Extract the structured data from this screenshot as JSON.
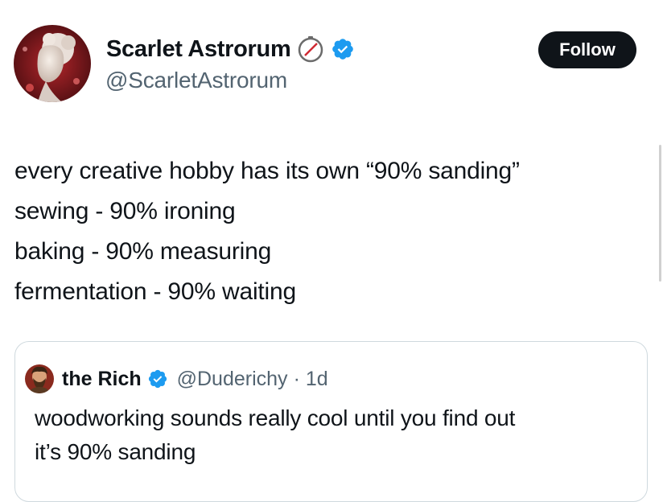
{
  "author": {
    "name": "Scarlet Astrorum",
    "handle": "@ScarletAstrorum",
    "avatar_icon": "statue-portrait-avatar",
    "badges": [
      "compass-icon",
      "verified-badge-icon"
    ]
  },
  "follow_label": "Follow",
  "tweet": {
    "lines": [
      "every creative hobby has its own “90% sanding”",
      "sewing - 90% ironing",
      "baking - 90% measuring",
      "fermentation - 90% waiting"
    ]
  },
  "quote": {
    "name": "the Rich",
    "handle": "@Duderichy",
    "separator": "·",
    "time": "1d",
    "lines": [
      "woodworking sounds really cool until you find out",
      "it’s 90% sanding"
    ]
  },
  "colors": {
    "text": "#0f1419",
    "muted": "#536471",
    "verified": "#1d9bf0",
    "follow_bg": "#0f1419",
    "border": "#cfd9de"
  }
}
